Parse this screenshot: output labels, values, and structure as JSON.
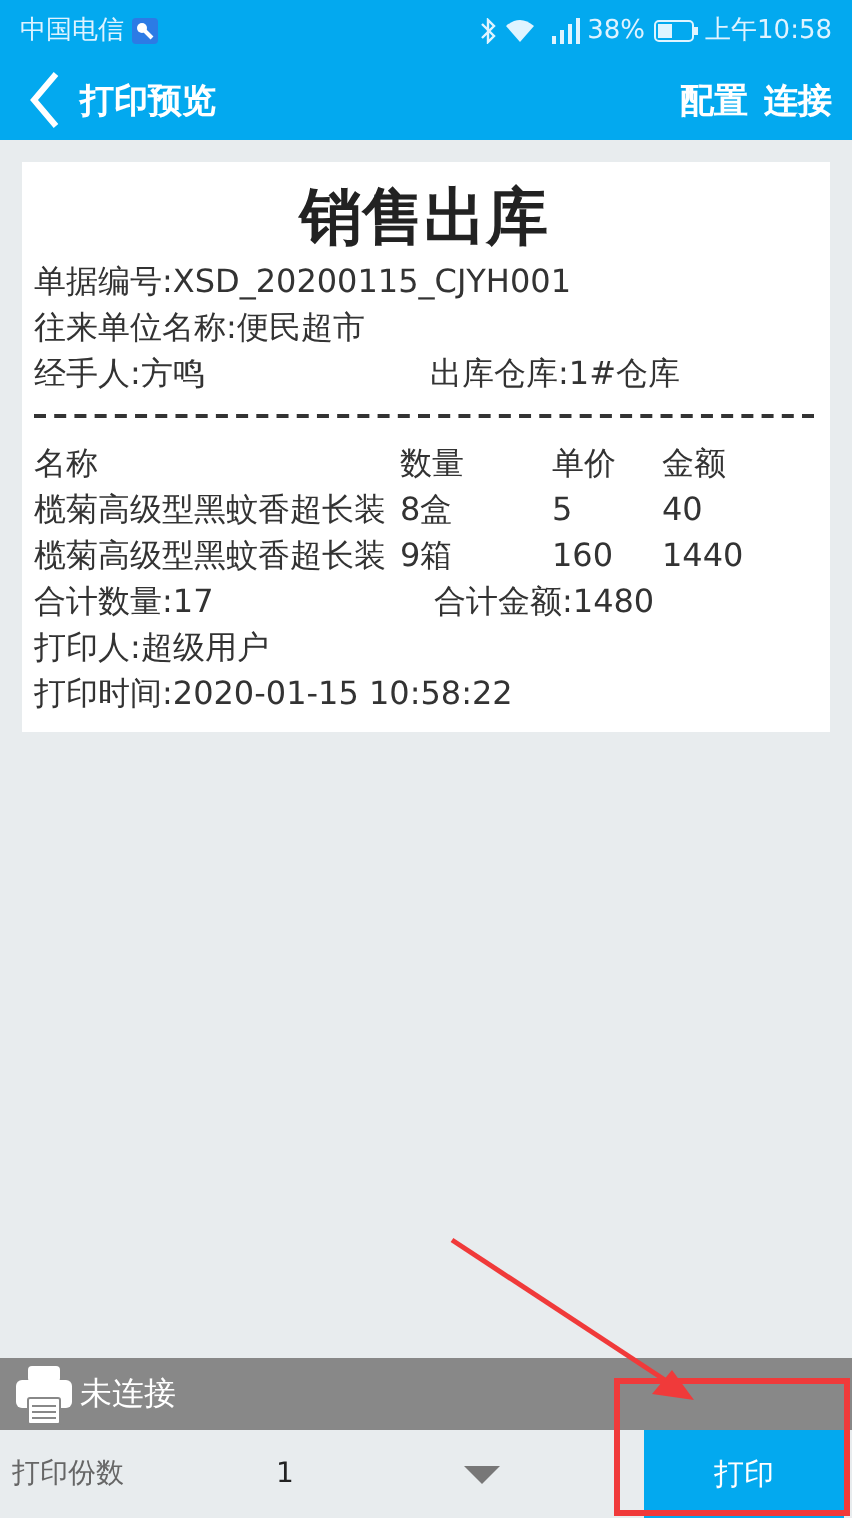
{
  "status_bar": {
    "carrier": "中国电信",
    "battery": "38%",
    "time": "上午10:58"
  },
  "header": {
    "title": "打印预览",
    "actions": [
      "配置",
      "连接"
    ]
  },
  "receipt": {
    "title": "销售出库",
    "info": [
      {
        "text": "单据编号:XSD_20200115_CJYH001"
      },
      {
        "text": "往来单位名称:便民超市"
      }
    ],
    "info_pair": [
      "经手人:方鸣",
      "出库仓库:1#仓库"
    ],
    "columns": [
      "名称",
      "数量",
      "单价",
      "金额"
    ],
    "rows": [
      [
        "榄菊高级型黑蚊香超长装",
        "8盒",
        "5",
        "40"
      ],
      [
        "榄菊高级型黑蚊香超长装",
        "9箱",
        "160",
        "1440"
      ]
    ],
    "totals": [
      "合计数量:17",
      "合计金额:1480"
    ],
    "footer": [
      "打印人:超级用户",
      "打印时间:2020-01-15 10:58:22"
    ]
  },
  "printer": {
    "status": "未连接",
    "connected": false
  },
  "copies": {
    "label": "打印份数",
    "value": "1"
  },
  "print_button": "打印"
}
